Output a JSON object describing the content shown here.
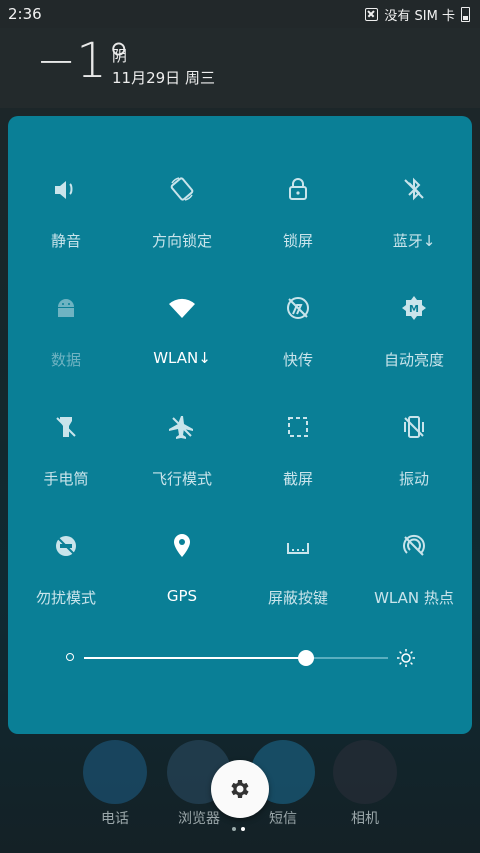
{
  "status_bar": {
    "time": "2:36",
    "carrier": "没有 SIM 卡"
  },
  "weather": {
    "temperature": "−1°",
    "condition": "阴",
    "date": "11月29日 周三"
  },
  "quick_settings": [
    {
      "label": "静音",
      "icon": "volume-icon",
      "state": "on"
    },
    {
      "label": "方向锁定",
      "icon": "rotation-icon",
      "state": "on"
    },
    {
      "label": "锁屏",
      "icon": "lock-icon",
      "state": "on"
    },
    {
      "label": "蓝牙↓",
      "icon": "bluetooth-off-icon",
      "state": "on"
    },
    {
      "label": "数据",
      "icon": "android-icon",
      "state": "disabled"
    },
    {
      "label": "WLAN↓",
      "icon": "wifi-icon",
      "state": "active"
    },
    {
      "label": "快传",
      "icon": "quick-transfer-icon",
      "state": "on"
    },
    {
      "label": "自动亮度",
      "icon": "auto-brightness-icon",
      "state": "on"
    },
    {
      "label": "手电筒",
      "icon": "flashlight-icon",
      "state": "on"
    },
    {
      "label": "飞行模式",
      "icon": "airplane-icon",
      "state": "on"
    },
    {
      "label": "截屏",
      "icon": "screenshot-icon",
      "state": "on"
    },
    {
      "label": "振动",
      "icon": "vibrate-icon",
      "state": "on"
    },
    {
      "label": "勿扰模式",
      "icon": "do-not-disturb-icon",
      "state": "on"
    },
    {
      "label": "GPS",
      "icon": "location-pin-icon",
      "state": "active"
    },
    {
      "label": "屏蔽按键",
      "icon": "block-keys-icon",
      "state": "on"
    },
    {
      "label": "WLAN 热点",
      "icon": "hotspot-icon",
      "state": "on"
    }
  ],
  "brightness": {
    "level": 0.73
  },
  "dock": [
    {
      "label": "电话",
      "icon": "phone-icon",
      "color": "#1e5f86"
    },
    {
      "label": "浏览器",
      "icon": "browser-icon",
      "color": "#2c4f66"
    },
    {
      "label": "短信",
      "icon": "messages-icon",
      "color": "#1b6d93"
    },
    {
      "label": "相机",
      "icon": "camera-icon",
      "color": "#2b2f3a"
    }
  ],
  "colors": {
    "panel": "#0a7f96",
    "active": "#ffffff",
    "inactive": "#c9e4eb"
  }
}
